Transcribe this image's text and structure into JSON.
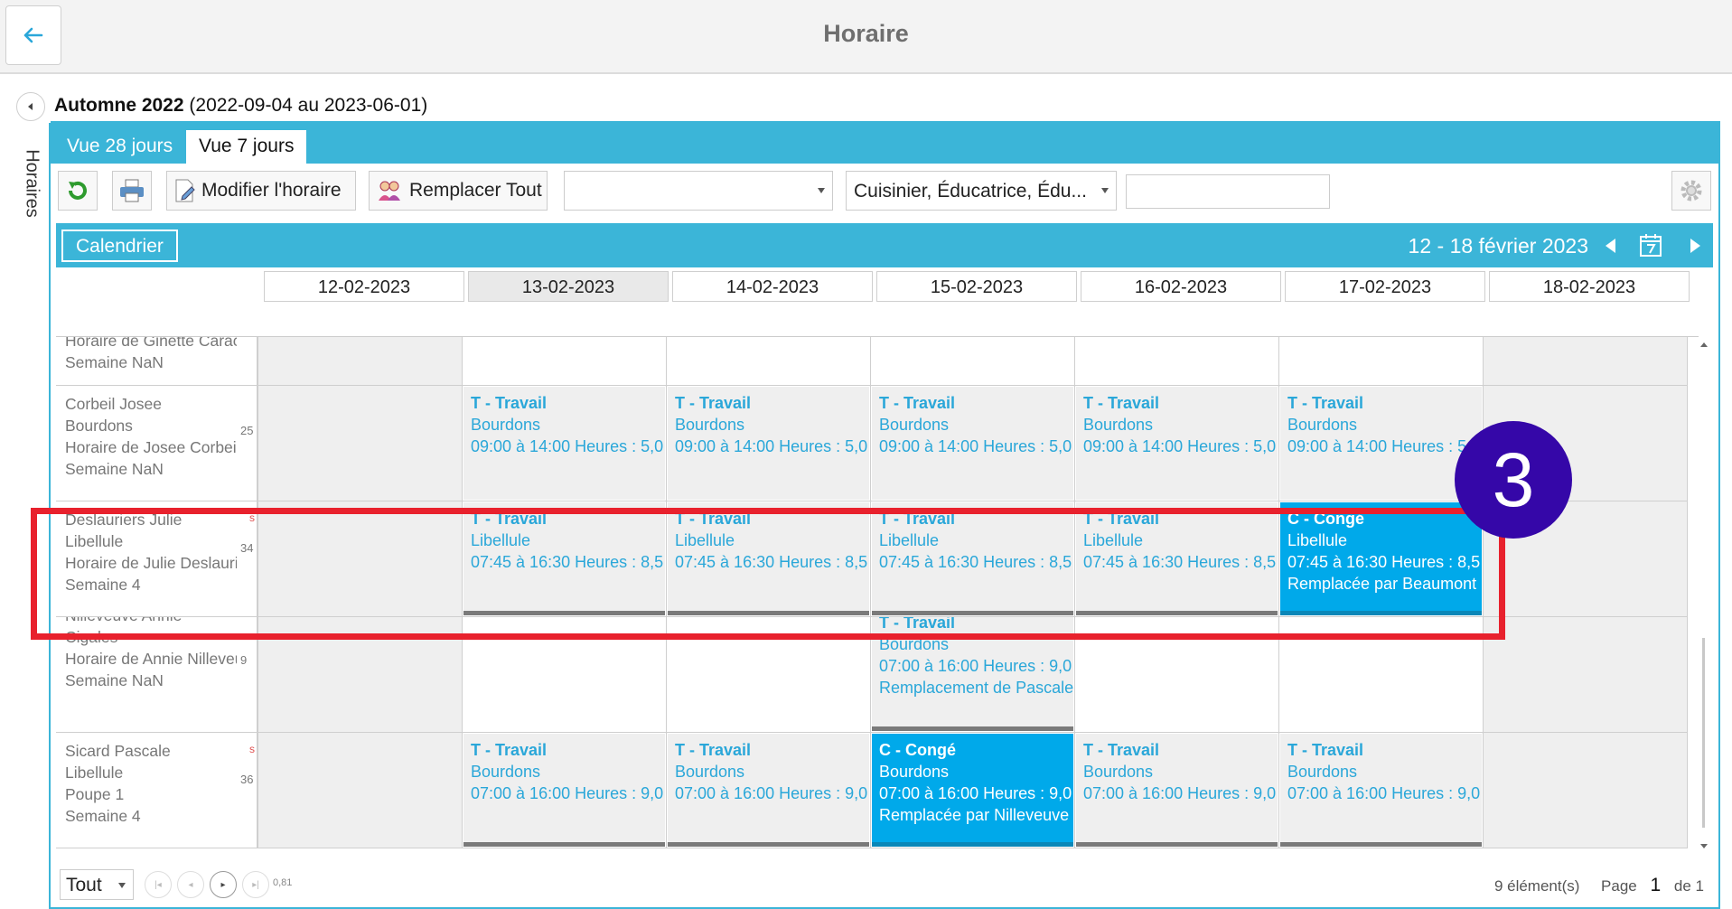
{
  "header": {
    "title": "Horaire"
  },
  "sidebar": {
    "vertical_tab_label": "Horaires"
  },
  "season": {
    "name": "Automne 2022",
    "range": "(2022-09-04 au 2023-06-01)"
  },
  "tabs": [
    {
      "label": "Vue 28 jours"
    },
    {
      "label": "Vue 7 jours"
    }
  ],
  "toolbar": {
    "edit_label": "Modifier l'horaire",
    "replace_label": "Remplacer Tout",
    "filter1_value": "",
    "filter2_value": "Cuisinier, Éducatrice, Édu...",
    "search_value": ""
  },
  "calendar": {
    "button_label": "Calendrier",
    "date_range": "12  - 18 février 2023"
  },
  "days": [
    "12-02-2023",
    "13-02-2023",
    "14-02-2023",
    "15-02-2023",
    "16-02-2023",
    "17-02-2023",
    "18-02-2023"
  ],
  "employees": [
    {
      "lines": [
        "Horaire de Ginette Carac",
        "Semaine NaN"
      ],
      "num": "",
      "red": ""
    },
    {
      "lines": [
        "Corbeil Josee",
        "Bourdons",
        "Horaire de Josee Corbei",
        "Semaine NaN"
      ],
      "num": "25",
      "red": ""
    },
    {
      "lines": [
        "Deslauriers Julie",
        "Libellule",
        "Horaire de Julie Deslauri",
        "Semaine 4"
      ],
      "num": "34",
      "red": "s"
    },
    {
      "lines": [
        "Nilleveuve Annie",
        "Cigales",
        "Horaire de Annie Nilleveu",
        "Semaine NaN"
      ],
      "num": "9",
      "red": ""
    },
    {
      "lines": [
        "Sicard Pascale",
        "Libellule",
        "Poupe 1",
        "Semaine 4"
      ],
      "num": "36",
      "red": "s"
    }
  ],
  "shifts": {
    "josee": {
      "type": "T - Travail",
      "group": "Bourdons",
      "time": "09:00 à 14:00  Heures : 5,0"
    },
    "julie_work": {
      "type": "T - Travail",
      "group": "Libellule",
      "time": "07:45 à 16:30  Heures : 8,5"
    },
    "julie_conge": {
      "type": "C - Congé",
      "group": "Libellule",
      "time": "07:45 à 16:30  Heures : 8,5",
      "note": "Remplacée par Beaumont"
    },
    "annie": {
      "type": "T - Travail",
      "group": "Bourdons",
      "time": "07:00 à 16:00  Heures : 9,0",
      "note": "Remplacement de Pascale"
    },
    "pascale_work": {
      "type": "T - Travail",
      "group": "Bourdons",
      "time": "07:00 à 16:00  Heures : 9,0"
    },
    "pascale_conge": {
      "type": "C - Congé",
      "group": "Bourdons",
      "time": "07:00 à 16:00  Heures : 9,0",
      "note": "Remplacée par Nilleveuve"
    }
  },
  "footer": {
    "page_size": "Tout",
    "version": "0,81",
    "items_count": "9 élément(s)",
    "page_label": "Page",
    "page_number": "1",
    "page_total": "de 1"
  },
  "overlay": {
    "step_badge": "3"
  },
  "colors": {
    "accent": "#3bb5d8",
    "conge": "#00a9ea",
    "work_text": "#2aa7d9",
    "highlight": "#e8212d",
    "badge": "#3507a8"
  }
}
